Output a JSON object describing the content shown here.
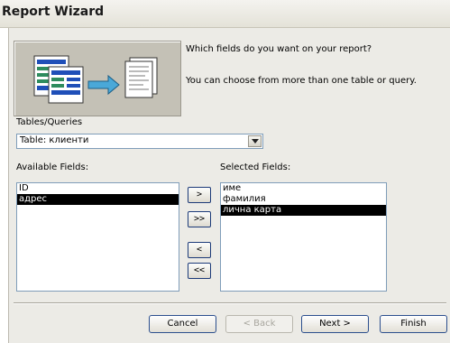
{
  "window": {
    "title": "Report Wizard"
  },
  "intro": {
    "line1": "Which fields do you want on your report?",
    "line2": "You can choose from more than one table or query."
  },
  "source": {
    "label": "Tables/Queries",
    "selected": "Table: клиенти"
  },
  "available": {
    "label": "Available Fields:",
    "items": [
      "ID",
      "адрес"
    ],
    "selected_index": 1
  },
  "selected_fields": {
    "label": "Selected Fields:",
    "items": [
      "име",
      "фамилия",
      "лична карта"
    ],
    "selected_index": 2
  },
  "move_buttons": {
    "add_one": ">",
    "add_all": ">>",
    "remove_one": "<",
    "remove_all": "<<"
  },
  "footer": {
    "cancel": "Cancel",
    "back": "< Back",
    "next": "Next >",
    "finish": "Finish"
  },
  "colors": {
    "dialog_bg": "#ecebe6",
    "selection": "#000000",
    "button_border": "#2c4f8e"
  }
}
